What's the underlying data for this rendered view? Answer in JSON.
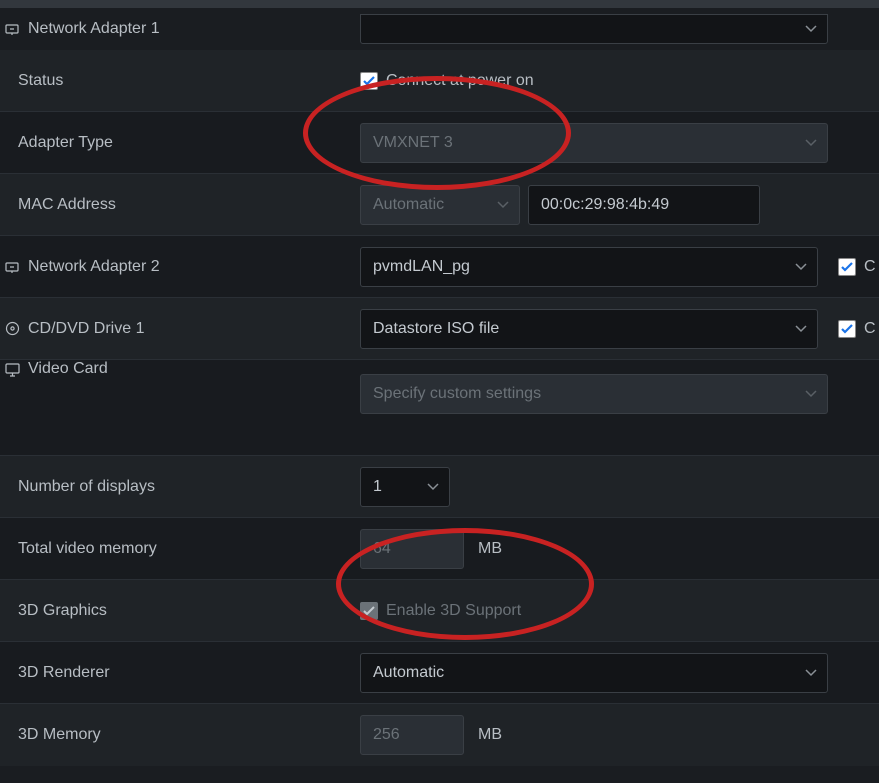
{
  "network_adapter_1": {
    "label": "Network Adapter 1",
    "network_value_partial": "",
    "status_label": "Status",
    "connect_label": "Connect at power on",
    "connect_checked": true,
    "adapter_type_label": "Adapter Type",
    "adapter_type_value": "VMXNET 3",
    "mac_label": "MAC Address",
    "mac_mode": "Automatic",
    "mac_value": "00:0c:29:98:4b:49"
  },
  "network_adapter_2": {
    "label": "Network Adapter 2",
    "value": "pvmdLAN_pg",
    "connect_partial": "C"
  },
  "cd_dvd": {
    "label": "CD/DVD Drive 1",
    "value": "Datastore ISO file",
    "connect_partial": "C"
  },
  "video_card": {
    "label": "Video Card",
    "settings_value": "Specify custom settings",
    "num_displays_label": "Number of displays",
    "num_displays_value": "1",
    "total_mem_label": "Total video memory",
    "total_mem_value": "64",
    "total_mem_unit": "MB",
    "graphics3d_label": "3D Graphics",
    "enable3d_label": "Enable 3D Support",
    "enable3d_checked": true,
    "renderer3d_label": "3D Renderer",
    "renderer3d_value": "Automatic",
    "memory3d_label": "3D Memory",
    "memory3d_value": "256",
    "memory3d_unit": "MB"
  }
}
